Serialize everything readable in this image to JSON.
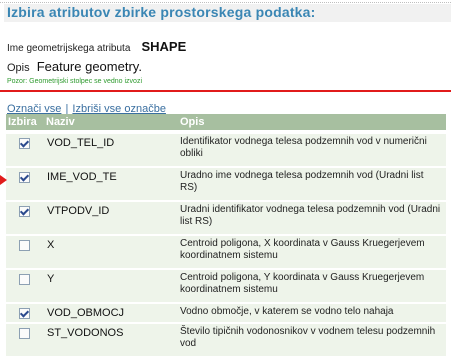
{
  "page": {
    "title": "Izbira atributov zbirke prostorskega podatka:"
  },
  "geometry": {
    "label": "Ime geometrijskega atributa",
    "value": "SHAPE",
    "opis_label": "Opis",
    "opis_value": "Feature geometry.",
    "note": "Pozor: Geometrijski stolpec se vedno izvozi"
  },
  "actions": {
    "select_all": "Označi vse",
    "separator": "|",
    "clear_all": "Izbriši vse označbe"
  },
  "table": {
    "columns": [
      "Izbira",
      "Naziv",
      "Opis"
    ],
    "rows": [
      {
        "checked": true,
        "name": "VOD_TEL_ID",
        "desc": "Identifikator vodnega telesa podzemnih vod v numerični obliki"
      },
      {
        "checked": true,
        "name": "IME_VOD_TE",
        "desc": "Uradno ime vodnega telesa podzemnih vod (Uradni list RS)"
      },
      {
        "checked": true,
        "name": "VTPODV_ID",
        "desc": "Uradni identifikator vodnega telesa podzemnih vod (Uradni list RS)"
      },
      {
        "checked": false,
        "name": "X",
        "desc": "Centroid poligona, X koordinata v Gauss Kruegerjevem koordinatnem sistemu"
      },
      {
        "checked": false,
        "name": "Y",
        "desc": "Centroid poligona, Y koordinata v Gauss Kruegerjevem koordinatnem sistemu"
      },
      {
        "checked": true,
        "name": "VOD_OBMOCJ",
        "desc": "Vodno območje, v katerem se vodno telo nahaja"
      },
      {
        "checked": false,
        "name": "ST_VODONOS",
        "desc": "Število tipičnih vodonosnikov v vodnem telesu podzemnih vod"
      }
    ]
  },
  "colors": {
    "title": "#3a86b4",
    "header_bg": "#a7bfa0",
    "row_bg": "#eef4ea",
    "note": "#2e9a2e",
    "accent_red": "#e11b1b"
  }
}
